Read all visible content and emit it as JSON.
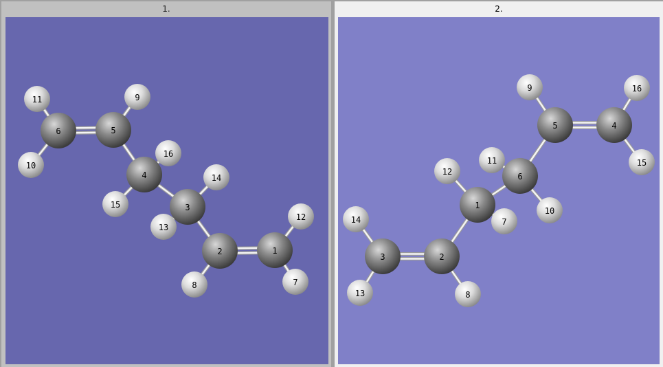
{
  "panels": [
    {
      "title": "1.",
      "background": "#6767ae",
      "atoms": [
        {
          "label": "1",
          "element": "C"
        },
        {
          "label": "2",
          "element": "C"
        },
        {
          "label": "3",
          "element": "C"
        },
        {
          "label": "4",
          "element": "C"
        },
        {
          "label": "5",
          "element": "C"
        },
        {
          "label": "6",
          "element": "C"
        },
        {
          "label": "7",
          "element": "H"
        },
        {
          "label": "8",
          "element": "H"
        },
        {
          "label": "9",
          "element": "H"
        },
        {
          "label": "10",
          "element": "H"
        },
        {
          "label": "11",
          "element": "H"
        },
        {
          "label": "12",
          "element": "H"
        },
        {
          "label": "13",
          "element": "H"
        },
        {
          "label": "14",
          "element": "H"
        },
        {
          "label": "15",
          "element": "H"
        },
        {
          "label": "16",
          "element": "H"
        }
      ],
      "bonds": [
        [
          "6",
          "5",
          2
        ],
        [
          "6",
          "11",
          1
        ],
        [
          "6",
          "10",
          1
        ],
        [
          "5",
          "9",
          1
        ],
        [
          "5",
          "4",
          1
        ],
        [
          "4",
          "16",
          1
        ],
        [
          "4",
          "15",
          1
        ],
        [
          "4",
          "3",
          1
        ],
        [
          "3",
          "14",
          1
        ],
        [
          "3",
          "13",
          1
        ],
        [
          "3",
          "2",
          1
        ],
        [
          "2",
          "1",
          2
        ],
        [
          "2",
          "8",
          1
        ],
        [
          "1",
          "12",
          1
        ],
        [
          "1",
          "7",
          1
        ]
      ]
    },
    {
      "title": "2.",
      "background": "#8080c8",
      "atoms": [
        {
          "label": "1",
          "element": "C"
        },
        {
          "label": "2",
          "element": "C"
        },
        {
          "label": "3",
          "element": "C"
        },
        {
          "label": "4",
          "element": "C"
        },
        {
          "label": "5",
          "element": "C"
        },
        {
          "label": "6",
          "element": "C"
        },
        {
          "label": "7",
          "element": "H"
        },
        {
          "label": "8",
          "element": "H"
        },
        {
          "label": "9",
          "element": "H"
        },
        {
          "label": "10",
          "element": "H"
        },
        {
          "label": "11",
          "element": "H"
        },
        {
          "label": "12",
          "element": "H"
        },
        {
          "label": "13",
          "element": "H"
        },
        {
          "label": "14",
          "element": "H"
        },
        {
          "label": "15",
          "element": "H"
        },
        {
          "label": "16",
          "element": "H"
        }
      ],
      "bonds": [
        [
          "5",
          "4",
          2
        ],
        [
          "5",
          "9",
          1
        ],
        [
          "4",
          "16",
          1
        ],
        [
          "4",
          "15",
          1
        ],
        [
          "5",
          "6",
          1
        ],
        [
          "6",
          "11",
          1
        ],
        [
          "6",
          "10",
          1
        ],
        [
          "6",
          "1",
          1
        ],
        [
          "1",
          "12",
          1
        ],
        [
          "1",
          "7",
          1
        ],
        [
          "1",
          "2",
          1
        ],
        [
          "2",
          "3",
          2
        ],
        [
          "2",
          "8",
          1
        ],
        [
          "3",
          "14",
          1
        ],
        [
          "3",
          "13",
          1
        ]
      ]
    }
  ]
}
